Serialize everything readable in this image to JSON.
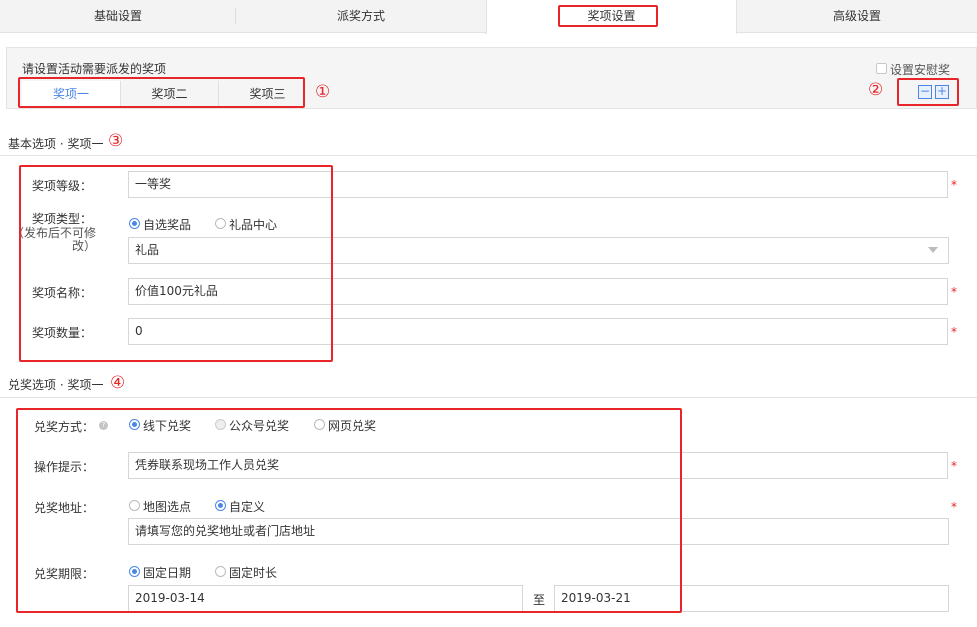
{
  "tabs": [
    "基础设置",
    "派奖方式",
    "奖项设置",
    "高级设置"
  ],
  "panel": {
    "title": "请设置活动需要派发的奖项",
    "consolation_label": "设置安慰奖",
    "sub_tabs": [
      "奖项一",
      "奖项二",
      "奖项三"
    ],
    "minus": "−",
    "plus": "+"
  },
  "markers": [
    "①",
    "②",
    "③",
    "④"
  ],
  "basic": {
    "title": "基本选项 · 奖项一",
    "level_label": "奖项等级：",
    "level_value": "一等奖",
    "type_label": "奖项类型：",
    "type_note_1": "（发布后不可修",
    "type_note_2": "改）",
    "type_options": [
      "自选奖品",
      "礼品中心"
    ],
    "type_select_value": "礼品",
    "name_label": "奖项名称：",
    "name_value": "价值100元礼品",
    "qty_label": "奖项数量：",
    "qty_value": "0",
    "required": "*"
  },
  "redeem": {
    "title": "兑奖选项 · 奖项一",
    "method_label": "兑奖方式：",
    "method_options": [
      "线下兑奖",
      "公众号兑奖",
      "网页兑奖"
    ],
    "hint_label": "操作提示：",
    "hint_value": "凭券联系现场工作人员兑奖",
    "address_label": "兑奖地址：",
    "address_options": [
      "地图选点",
      "自定义"
    ],
    "address_placeholder": "请填写您的兑奖地址或者门店地址",
    "period_label": "兑奖期限：",
    "period_options": [
      "固定日期",
      "固定时长"
    ],
    "start_date": "2019-03-14",
    "to": "至",
    "end_date": "2019-03-21",
    "required": "*"
  }
}
